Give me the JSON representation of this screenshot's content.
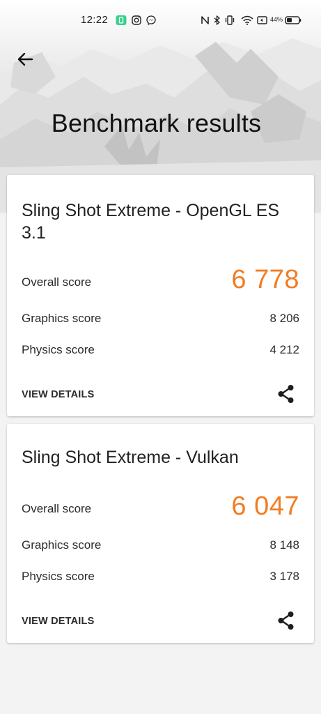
{
  "status_bar": {
    "time": "12:22",
    "battery_percent": "44%",
    "icons": [
      "notification-app-icon",
      "instagram-icon",
      "messenger-icon",
      "nfc-icon",
      "bluetooth-icon",
      "vibrate-icon",
      "wifi-icon",
      "battery-saver-icon",
      "battery-icon"
    ]
  },
  "header": {
    "back_icon": "arrow-left-icon",
    "title": "Benchmark results"
  },
  "cards": [
    {
      "title": "Sling Shot Extreme - OpenGL ES 3.1",
      "overall": {
        "label": "Overall score",
        "value": "6 778"
      },
      "graphics": {
        "label": "Graphics score",
        "value": "8 206"
      },
      "physics": {
        "label": "Physics score",
        "value": "4 212"
      },
      "view_details": "VIEW DETAILS",
      "share_icon": "share-icon"
    },
    {
      "title": "Sling Shot Extreme - Vulkan",
      "overall": {
        "label": "Overall score",
        "value": "6 047"
      },
      "graphics": {
        "label": "Graphics score",
        "value": "8 148"
      },
      "physics": {
        "label": "Physics score",
        "value": "3 178"
      },
      "view_details": "VIEW DETAILS",
      "share_icon": "share-icon"
    }
  ],
  "colors": {
    "accent": "#f07d24",
    "background": "#f3f3f3",
    "card": "#ffffff",
    "text": "#222222",
    "notification_green": "#3ccf8e"
  }
}
